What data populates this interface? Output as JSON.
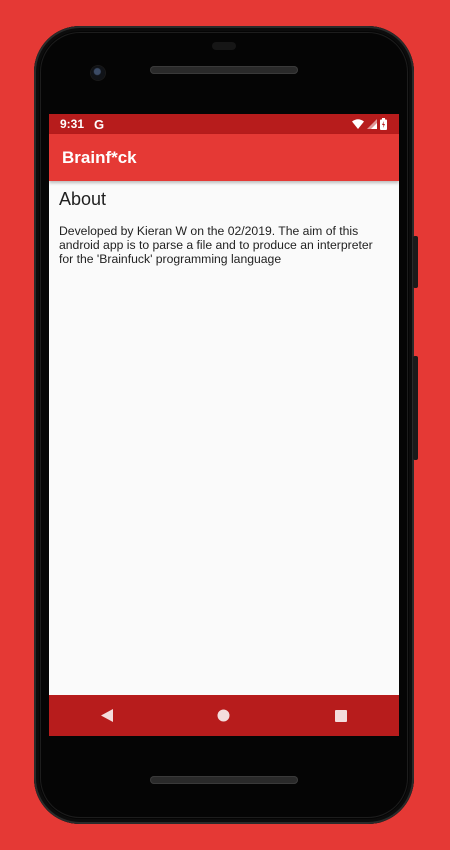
{
  "status_bar": {
    "time": "9:31",
    "google_glyph": "G",
    "icons": [
      "wifi-icon",
      "signal-icon",
      "battery-icon"
    ]
  },
  "app_bar": {
    "title": "Brainf*ck"
  },
  "content": {
    "heading": "About",
    "body": "Developed by Kieran W on the 02/2019. The aim of this android app is to parse a file and to produce an interpreter for the 'Brainfuck' programming language"
  },
  "nav_bar": {
    "buttons": [
      "back-icon",
      "home-icon",
      "recents-icon"
    ]
  },
  "colors": {
    "background": "#e53935",
    "app_bar": "#e53935",
    "status_bar": "#b71c1c",
    "nav_bar": "#b71c1c",
    "screen": "#fafafa"
  }
}
